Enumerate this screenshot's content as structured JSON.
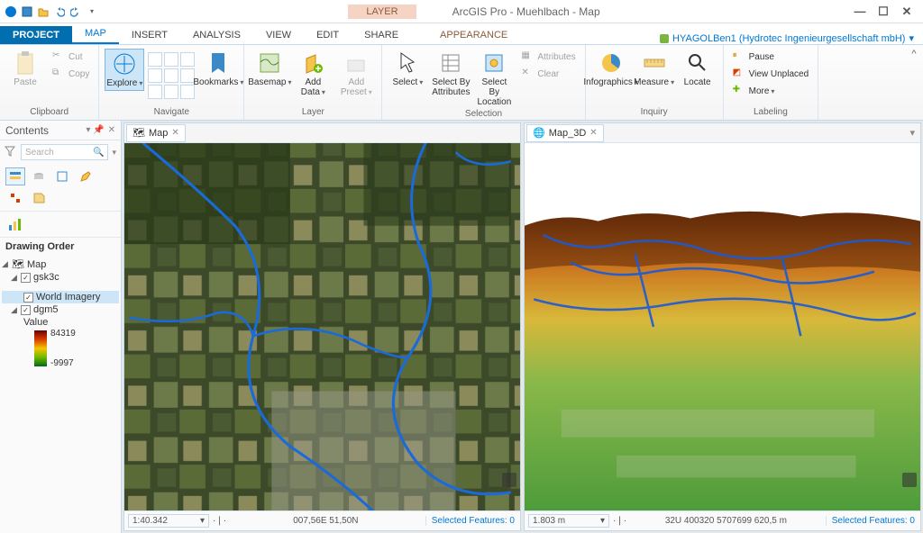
{
  "titlebar": {
    "context_group": "LAYER",
    "app_title": "ArcGIS Pro - Muehlbach - Map",
    "user": "HYAGOLBen1 (Hydrotec Ingenieurgesellschaft mbH)"
  },
  "tabs": {
    "project": "PROJECT",
    "map": "MAP",
    "insert": "INSERT",
    "analysis": "ANALYSIS",
    "view": "VIEW",
    "edit": "EDIT",
    "share": "SHARE",
    "appearance": "APPEARANCE"
  },
  "ribbon": {
    "clipboard": {
      "label": "Clipboard",
      "paste": "Paste",
      "cut": "Cut",
      "copy": "Copy"
    },
    "navigate": {
      "label": "Navigate",
      "explore": "Explore",
      "bookmarks": "Bookmarks"
    },
    "layer": {
      "label": "Layer",
      "basemap": "Basemap",
      "add_data": "Add Data",
      "add_preset": "Add Preset"
    },
    "selection": {
      "label": "Selection",
      "select": "Select",
      "by_attr": "Select By Attributes",
      "by_loc": "Select By Location",
      "attributes": "Attributes",
      "clear": "Clear"
    },
    "inquiry": {
      "label": "Inquiry",
      "infographics": "Infographics",
      "measure": "Measure",
      "locate": "Locate"
    },
    "labeling": {
      "label": "Labeling",
      "pause": "Pause",
      "view_unplaced": "View Unplaced",
      "more": "More"
    }
  },
  "contents": {
    "title": "Contents",
    "search_placeholder": "Search",
    "drawing_order": "Drawing Order",
    "root": "Map",
    "layers": {
      "gsk3c": "gsk3c",
      "world_imagery": "World Imagery",
      "dgm5": "dgm5",
      "value_label": "Value",
      "value_max": "84319",
      "value_min": "-9997"
    }
  },
  "views": {
    "map": {
      "tab": "Map",
      "scale": "1:40.342",
      "coords": "007,56E 51,50N",
      "selected": "Selected Features: 0"
    },
    "map3d": {
      "tab": "Map_3D",
      "scale": "1.803 m",
      "coords": "32U 400320 5707699   620,5 m",
      "selected": "Selected Features: 0"
    }
  }
}
